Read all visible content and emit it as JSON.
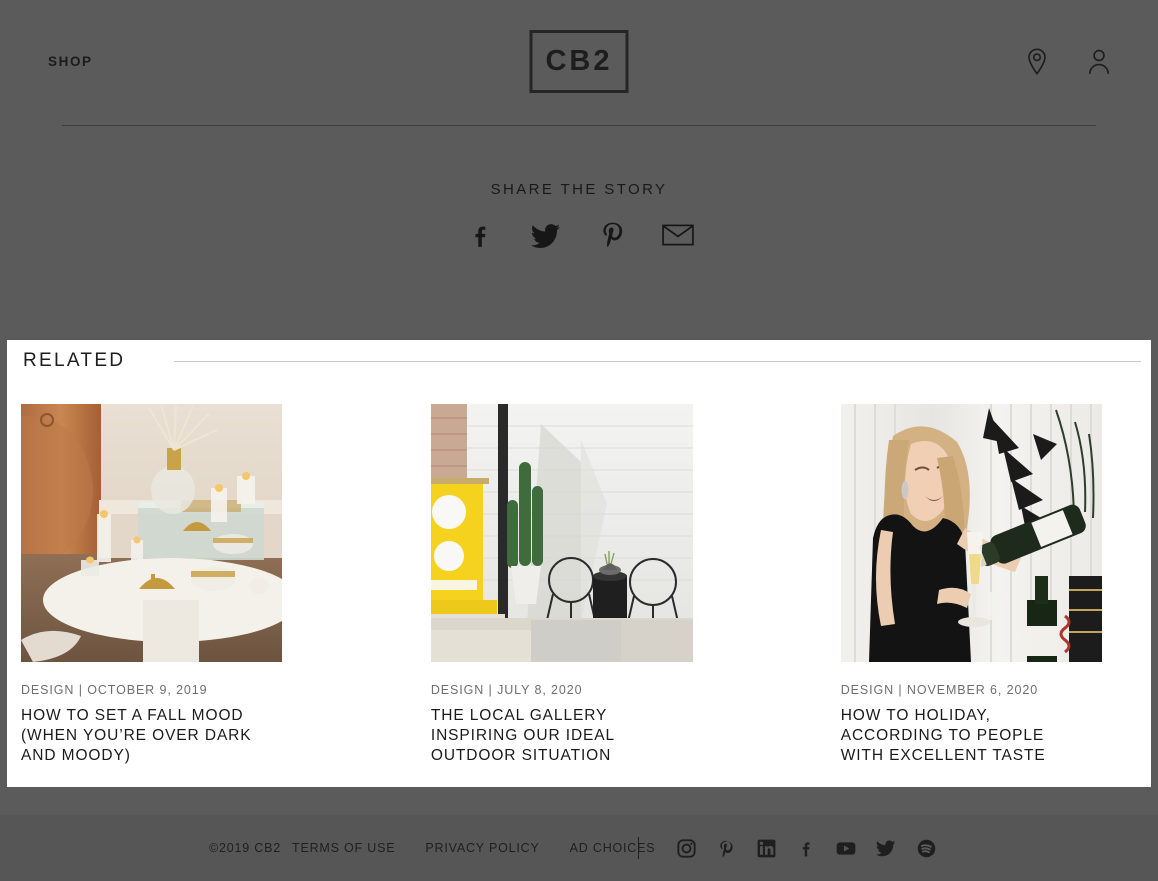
{
  "header": {
    "shop_label": "SHOP",
    "logo_text": "CB2",
    "icons": [
      {
        "name": "location-pin-icon",
        "label": "Store Locator"
      },
      {
        "name": "user-account-icon",
        "label": "Account"
      }
    ]
  },
  "share": {
    "title": "SHARE THE STORY",
    "icons": [
      {
        "name": "facebook-icon",
        "label": "Facebook"
      },
      {
        "name": "twitter-icon",
        "label": "Twitter"
      },
      {
        "name": "pinterest-icon",
        "label": "Pinterest"
      },
      {
        "name": "email-icon",
        "label": "Email"
      }
    ]
  },
  "related": {
    "title": "RELATED",
    "cards": [
      {
        "category": "DESIGN",
        "separator": "|",
        "date": "OCTOBER 9, 2019",
        "meta": "DESIGN | OCTOBER 9, 2019",
        "heading": "HOW TO SET A FALL MOOD (WHEN YOU’RE OVER DARK AND MOODY)",
        "image_alt": "Candles and mirrored tray on a white round table in a warm wood-panelled room"
      },
      {
        "category": "DESIGN",
        "separator": "|",
        "date": "JULY 8, 2020",
        "meta": "DESIGN | JULY 8, 2020",
        "heading": "THE LOCAL GALLERY INSPIRING OUR IDEAL OUTDOOR SITUATION",
        "image_alt": "White brick patio with yellow sculpture, tall cactus and two white wire chairs"
      },
      {
        "category": "DESIGN",
        "separator": "|",
        "date": "NOVEMBER 6, 2020",
        "meta": "DESIGN | NOVEMBER 6, 2020",
        "heading": "HOW TO HOLIDAY, ACCORDING TO PEOPLE WITH EXCELLENT TASTE",
        "image_alt": "Woman in a black dress pouring champagne next to black palm leaves"
      }
    ]
  },
  "footer": {
    "copyright": "©2019 CB2",
    "links": [
      {
        "label": "TERMS OF USE"
      },
      {
        "label": "PRIVACY POLICY"
      },
      {
        "label": "AD CHOICES"
      }
    ],
    "social": [
      {
        "name": "instagram-icon",
        "label": "Instagram"
      },
      {
        "name": "pinterest-icon",
        "label": "Pinterest"
      },
      {
        "name": "linkedin-icon",
        "label": "LinkedIn"
      },
      {
        "name": "facebook-icon",
        "label": "Facebook"
      },
      {
        "name": "youtube-icon",
        "label": "YouTube"
      },
      {
        "name": "twitter-icon",
        "label": "Twitter"
      },
      {
        "name": "spotify-icon",
        "label": "Spotify"
      }
    ]
  },
  "colors": {
    "overlay": "#5b5b5b",
    "footer_bg": "#565656",
    "panel_bg": "#ffffff",
    "text_dark": "#1b1b1b",
    "text_muted": "#6f6f6f",
    "rule": "#c9c9c9"
  }
}
